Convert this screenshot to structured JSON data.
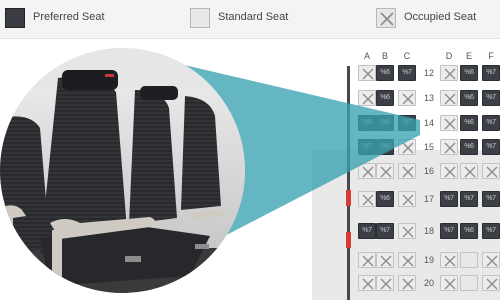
{
  "legend": {
    "preferred": "Preferred Seat",
    "standard": "Standard Seat",
    "occupied": "Occupied Seat"
  },
  "columns": [
    "A",
    "B",
    "C",
    "D",
    "E",
    "F"
  ],
  "rows": [
    {
      "num": "12",
      "seats": [
        "occ",
        "pref",
        "pref",
        "occ",
        "pref",
        "pref"
      ],
      "codes": [
        "",
        "%6",
        "%7",
        "",
        "%6",
        "%7"
      ]
    },
    {
      "num": "13",
      "seats": [
        "occ",
        "pref",
        "occ",
        "occ",
        "pref",
        "pref"
      ],
      "codes": [
        "",
        "%6",
        "",
        "",
        "%6",
        "%7"
      ]
    },
    {
      "num": "14",
      "seats": [
        "pref",
        "pref",
        "pref",
        "occ",
        "pref",
        "pref"
      ],
      "codes": [
        "%6",
        "%6",
        "%7",
        "",
        "%6",
        "%7"
      ]
    },
    {
      "num": "15",
      "seats": [
        "pref",
        "pref",
        "occ",
        "occ",
        "pref",
        "pref"
      ],
      "codes": [
        "%7",
        "%6",
        "",
        "",
        "%6",
        "%7"
      ]
    },
    {
      "num": "16",
      "seats": [
        "occ",
        "occ",
        "occ",
        "occ",
        "occ",
        "occ"
      ],
      "codes": [
        "",
        "",
        "",
        "",
        "",
        ""
      ]
    },
    {
      "num": "17",
      "seats": [
        "occ",
        "pref",
        "occ",
        "pref",
        "pref",
        "pref"
      ],
      "codes": [
        "",
        "%6",
        "",
        "%7",
        "%7",
        "%7"
      ]
    },
    {
      "num": "18",
      "seats": [
        "pref",
        "pref",
        "occ",
        "pref",
        "pref",
        "pref"
      ],
      "codes": [
        "%7",
        "%7",
        "",
        "%7",
        "%6",
        "%7"
      ]
    },
    {
      "num": "19",
      "seats": [
        "occ",
        "occ",
        "occ",
        "occ",
        "std",
        "occ"
      ],
      "codes": [
        "",
        "",
        "",
        "",
        "",
        ""
      ]
    },
    {
      "num": "20",
      "seats": [
        "occ",
        "occ",
        "occ",
        "occ",
        "std",
        "occ"
      ],
      "codes": [
        "",
        "",
        "",
        "",
        "",
        ""
      ]
    }
  ],
  "colors": {
    "preferred": "#3c4046",
    "standard": "#e8e8e8",
    "occupied": "#ececec",
    "aisle": "#45494e",
    "exit": "#d63a3a",
    "cone": "#3aa2b2"
  },
  "icons": {
    "occupied": "x-mark-icon"
  }
}
